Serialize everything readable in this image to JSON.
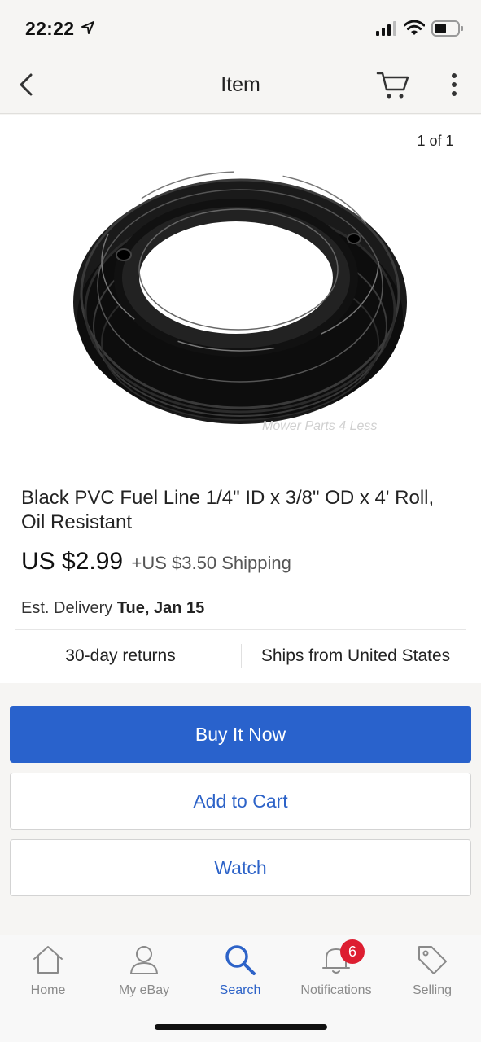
{
  "status_bar": {
    "time": "22:22",
    "icons": [
      "location-arrow-icon",
      "signal-icon",
      "wifi-icon",
      "battery-icon"
    ]
  },
  "nav": {
    "title": "Item",
    "icons": [
      "back-chevron-icon",
      "cart-icon",
      "more-vertical-icon"
    ]
  },
  "gallery": {
    "counter": "1 of 1",
    "watermark": "Mower Parts 4 Less"
  },
  "item": {
    "title": "Black PVC Fuel Line 1/4\" ID x 3/8\" OD x 4' Roll, Oil Resistant",
    "price": "US $2.99",
    "shipping": "+US $3.50 Shipping",
    "delivery_label": "Est. Delivery",
    "delivery_date": "Tue, Jan 15",
    "returns": "30-day returns",
    "ships_from": "Ships from United States"
  },
  "actions": {
    "buy_now": "Buy It Now",
    "add_to_cart": "Add to Cart",
    "watch": "Watch"
  },
  "tabs": [
    {
      "label": "Home",
      "icon": "home-icon",
      "active": false
    },
    {
      "label": "My eBay",
      "icon": "user-icon",
      "active": false
    },
    {
      "label": "Search",
      "icon": "search-icon",
      "active": true
    },
    {
      "label": "Notifications",
      "icon": "bell-icon",
      "active": false,
      "badge": "6"
    },
    {
      "label": "Selling",
      "icon": "tag-icon",
      "active": false
    }
  ],
  "colors": {
    "primary_blue": "#2962cc",
    "link_blue": "#2d63c8",
    "badge_red": "#dd1e31",
    "background": "#f6f5f3"
  }
}
